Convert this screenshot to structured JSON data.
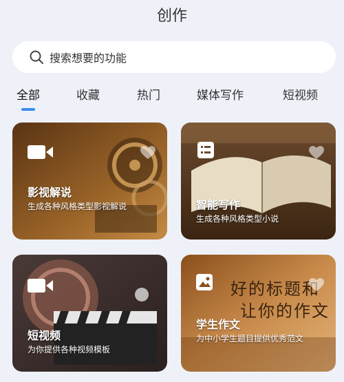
{
  "page": {
    "title": "创作"
  },
  "search": {
    "placeholder": "搜索想要的功能"
  },
  "tabs": [
    {
      "label": "全部",
      "active": true
    },
    {
      "label": "收藏",
      "active": false
    },
    {
      "label": "热门",
      "active": false
    },
    {
      "label": "媒体写作",
      "active": false
    },
    {
      "label": "短视频",
      "active": false
    }
  ],
  "cards": [
    {
      "name": "影视解说",
      "desc": "生成各种风格类型影视解说",
      "icon": "video-camera-icon"
    },
    {
      "name": "智能写作",
      "desc": "生成各种风格类型小说",
      "icon": "document-list-icon"
    },
    {
      "name": "短视频",
      "desc": "为你提供各种视频模板",
      "icon": "video-camera-icon"
    },
    {
      "name": "学生作文",
      "desc": "为中小学生题目提供优秀范文",
      "icon": "image-icon"
    }
  ],
  "card4_calligraphy": {
    "line1": "好的标题和",
    "line2": "让你的作文"
  },
  "colors": {
    "accent": "#3b8cf0",
    "background": "#eef1f8"
  }
}
